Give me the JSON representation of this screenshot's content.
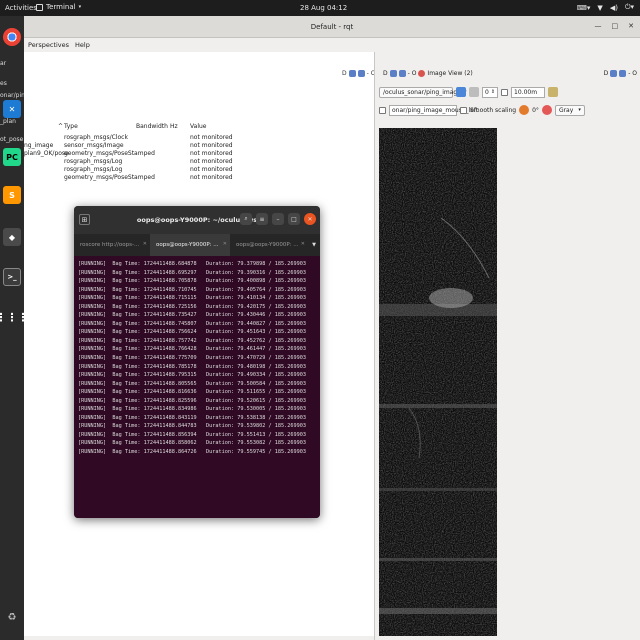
{
  "topbar": {
    "activities": "Activities",
    "app_name": "Terminal",
    "clock": "28 Aug  04:12"
  },
  "desktop_labels": [
    "es",
    "ar",
    "onar/ping_image",
    "_plan",
    "ot_pose",
    "es",
    "pose"
  ],
  "rqt": {
    "title": "Default - rqt",
    "menu": [
      "Perspectives",
      "Help"
    ],
    "topic_monitor": {
      "columns": [
        "Type",
        "Bandwidth",
        "Hz",
        "Value"
      ],
      "topic_names": [
        "",
        "ng_image",
        "plan9_OK/pose",
        "",
        "",
        ""
      ],
      "rows": [
        {
          "type": "rosgraph_msgs/Clock",
          "value": "not monitored"
        },
        {
          "type": "sensor_msgs/Image",
          "value": "not monitored"
        },
        {
          "type": "geometry_msgs/PoseStamped",
          "value": "not monitored"
        },
        {
          "type": "rosgraph_msgs/Log",
          "value": "not monitored"
        },
        {
          "type": "rosgraph_msgs/Log",
          "value": "not monitored"
        },
        {
          "type": "geometry_msgs/PoseStamped",
          "value": "not monitored"
        }
      ],
      "ctrl_glyphs": "D",
      "ctrl_close": "- O"
    },
    "image_view": {
      "title": "Image View (2)",
      "ctrl_glyphs": "D",
      "ctrl_close": "- O",
      "topic": "/oculus_sonar/ping_image",
      "spin_value": "0",
      "time_value": "10.00m",
      "mouse_topic": "onar/ping_image_mouse_left",
      "smooth_label": "Smooth scaling",
      "rotation": "0°",
      "colormap": "Gray"
    }
  },
  "terminal": {
    "title": "oops@oops-Y9000P: ~/oculus_ws",
    "tabs": [
      "roscore http://oops-...",
      "oops@oops-Y9000P: ...",
      "oops@oops-Y9000P: ..."
    ],
    "lines": [
      "[RUNNING]  Bag Time: 1724411488.684878   Duration: 79.379898 / 185.269903",
      "[RUNNING]  Bag Time: 1724411488.695297   Duration: 79.390316 / 185.269903",
      "[RUNNING]  Bag Time: 1724411488.705878   Duration: 79.400898 / 185.269903",
      "[RUNNING]  Bag Time: 1724411488.710745   Duration: 79.405764 / 185.269903",
      "[RUNNING]  Bag Time: 1724411488.715115   Duration: 79.410134 / 185.269903",
      "[RUNNING]  Bag Time: 1724411488.725156   Duration: 79.420175 / 185.269903",
      "[RUNNING]  Bag Time: 1724411488.735427   Duration: 79.430446 / 185.269903",
      "[RUNNING]  Bag Time: 1724411488.745807   Duration: 79.440827 / 185.269903",
      "[RUNNING]  Bag Time: 1724411488.756624   Duration: 79.451643 / 185.269903",
      "[RUNNING]  Bag Time: 1724411488.757742   Duration: 79.452762 / 185.269903",
      "[RUNNING]  Bag Time: 1724411488.766428   Duration: 79.461447 / 185.269903",
      "[RUNNING]  Bag Time: 1724411488.775709   Duration: 79.470729 / 185.269903",
      "[RUNNING]  Bag Time: 1724411488.785178   Duration: 79.480198 / 185.269903",
      "[RUNNING]  Bag Time: 1724411488.795315   Duration: 79.490334 / 185.269903",
      "[RUNNING]  Bag Time: 1724411488.805565   Duration: 79.500584 / 185.269903",
      "[RUNNING]  Bag Time: 1724411488.816636   Duration: 79.511655 / 185.269903",
      "[RUNNING]  Bag Time: 1724411488.825596   Duration: 79.520615 / 185.269903",
      "[RUNNING]  Bag Time: 1724411488.834986   Duration: 79.530005 / 185.269903",
      "[RUNNING]  Bag Time: 1724411488.843119   Duration: 79.538138 / 185.269903",
      "[RUNNING]  Bag Time: 1724411488.844783   Duration: 79.539802 / 185.269903",
      "[RUNNING]  Bag Time: 1724411488.856394   Duration: 79.551413 / 185.269903",
      "[RUNNING]  Bag Time: 1724411488.858062   Duration: 79.553082 / 185.269903",
      "[RUNNING]  Bag Time: 1724411488.864726   Duration: 79.559745 / 185.269903"
    ]
  },
  "colors": {
    "topbar": "#1d1d1d",
    "dock": "#2b2b2b",
    "terminal_bg": "#300a24",
    "terminal_close": "#e95420",
    "sonar_bg": "#0b0b0b"
  }
}
